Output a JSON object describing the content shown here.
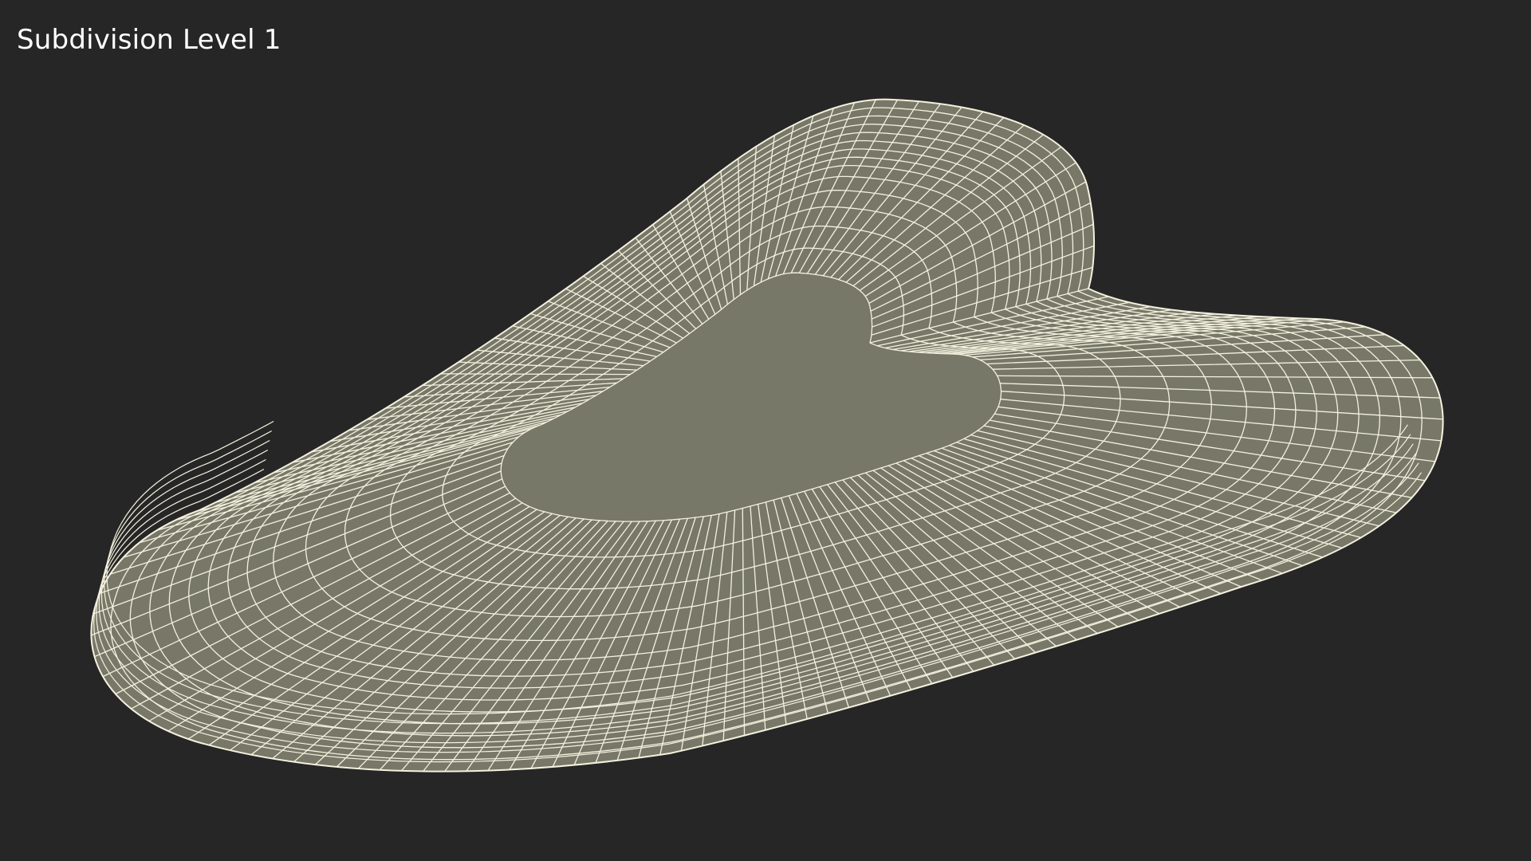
{
  "viewport": {
    "title": "Subdivision Level 1",
    "background_color": "#262626",
    "surface_color": "#787869",
    "wire_color": "#f4f1de",
    "subject": "gua-sha-stone-icon"
  }
}
